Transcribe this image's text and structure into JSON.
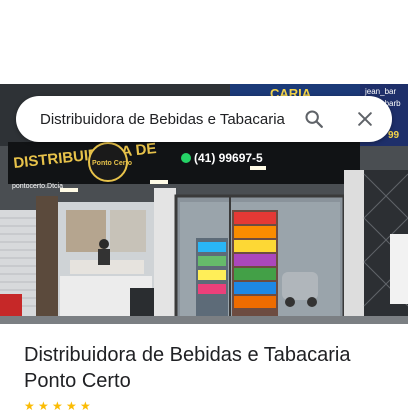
{
  "search": {
    "value": "Distribuidora de Bebidas e Tabacaria",
    "search_icon": "search-icon",
    "close_icon": "close-icon"
  },
  "photo": {
    "sign_text": "DISTRIBUIDORA DE",
    "logo_text": "Ponto Certo",
    "phone_text": "(41) 99697-5",
    "instagram_text": "pontocerto.Dtcia",
    "top_right_text_1": "jean_bar",
    "top_right_text_2": "jean_barb",
    "partial_sign": "CARIA",
    "partial_number": "99"
  },
  "place": {
    "name": "Distribuidora de Bebidas e Tabacaria Ponto Certo"
  },
  "colors": {
    "accent_star": "#fbbc04",
    "text_primary": "#202124",
    "icon_gray": "#5f6368"
  }
}
